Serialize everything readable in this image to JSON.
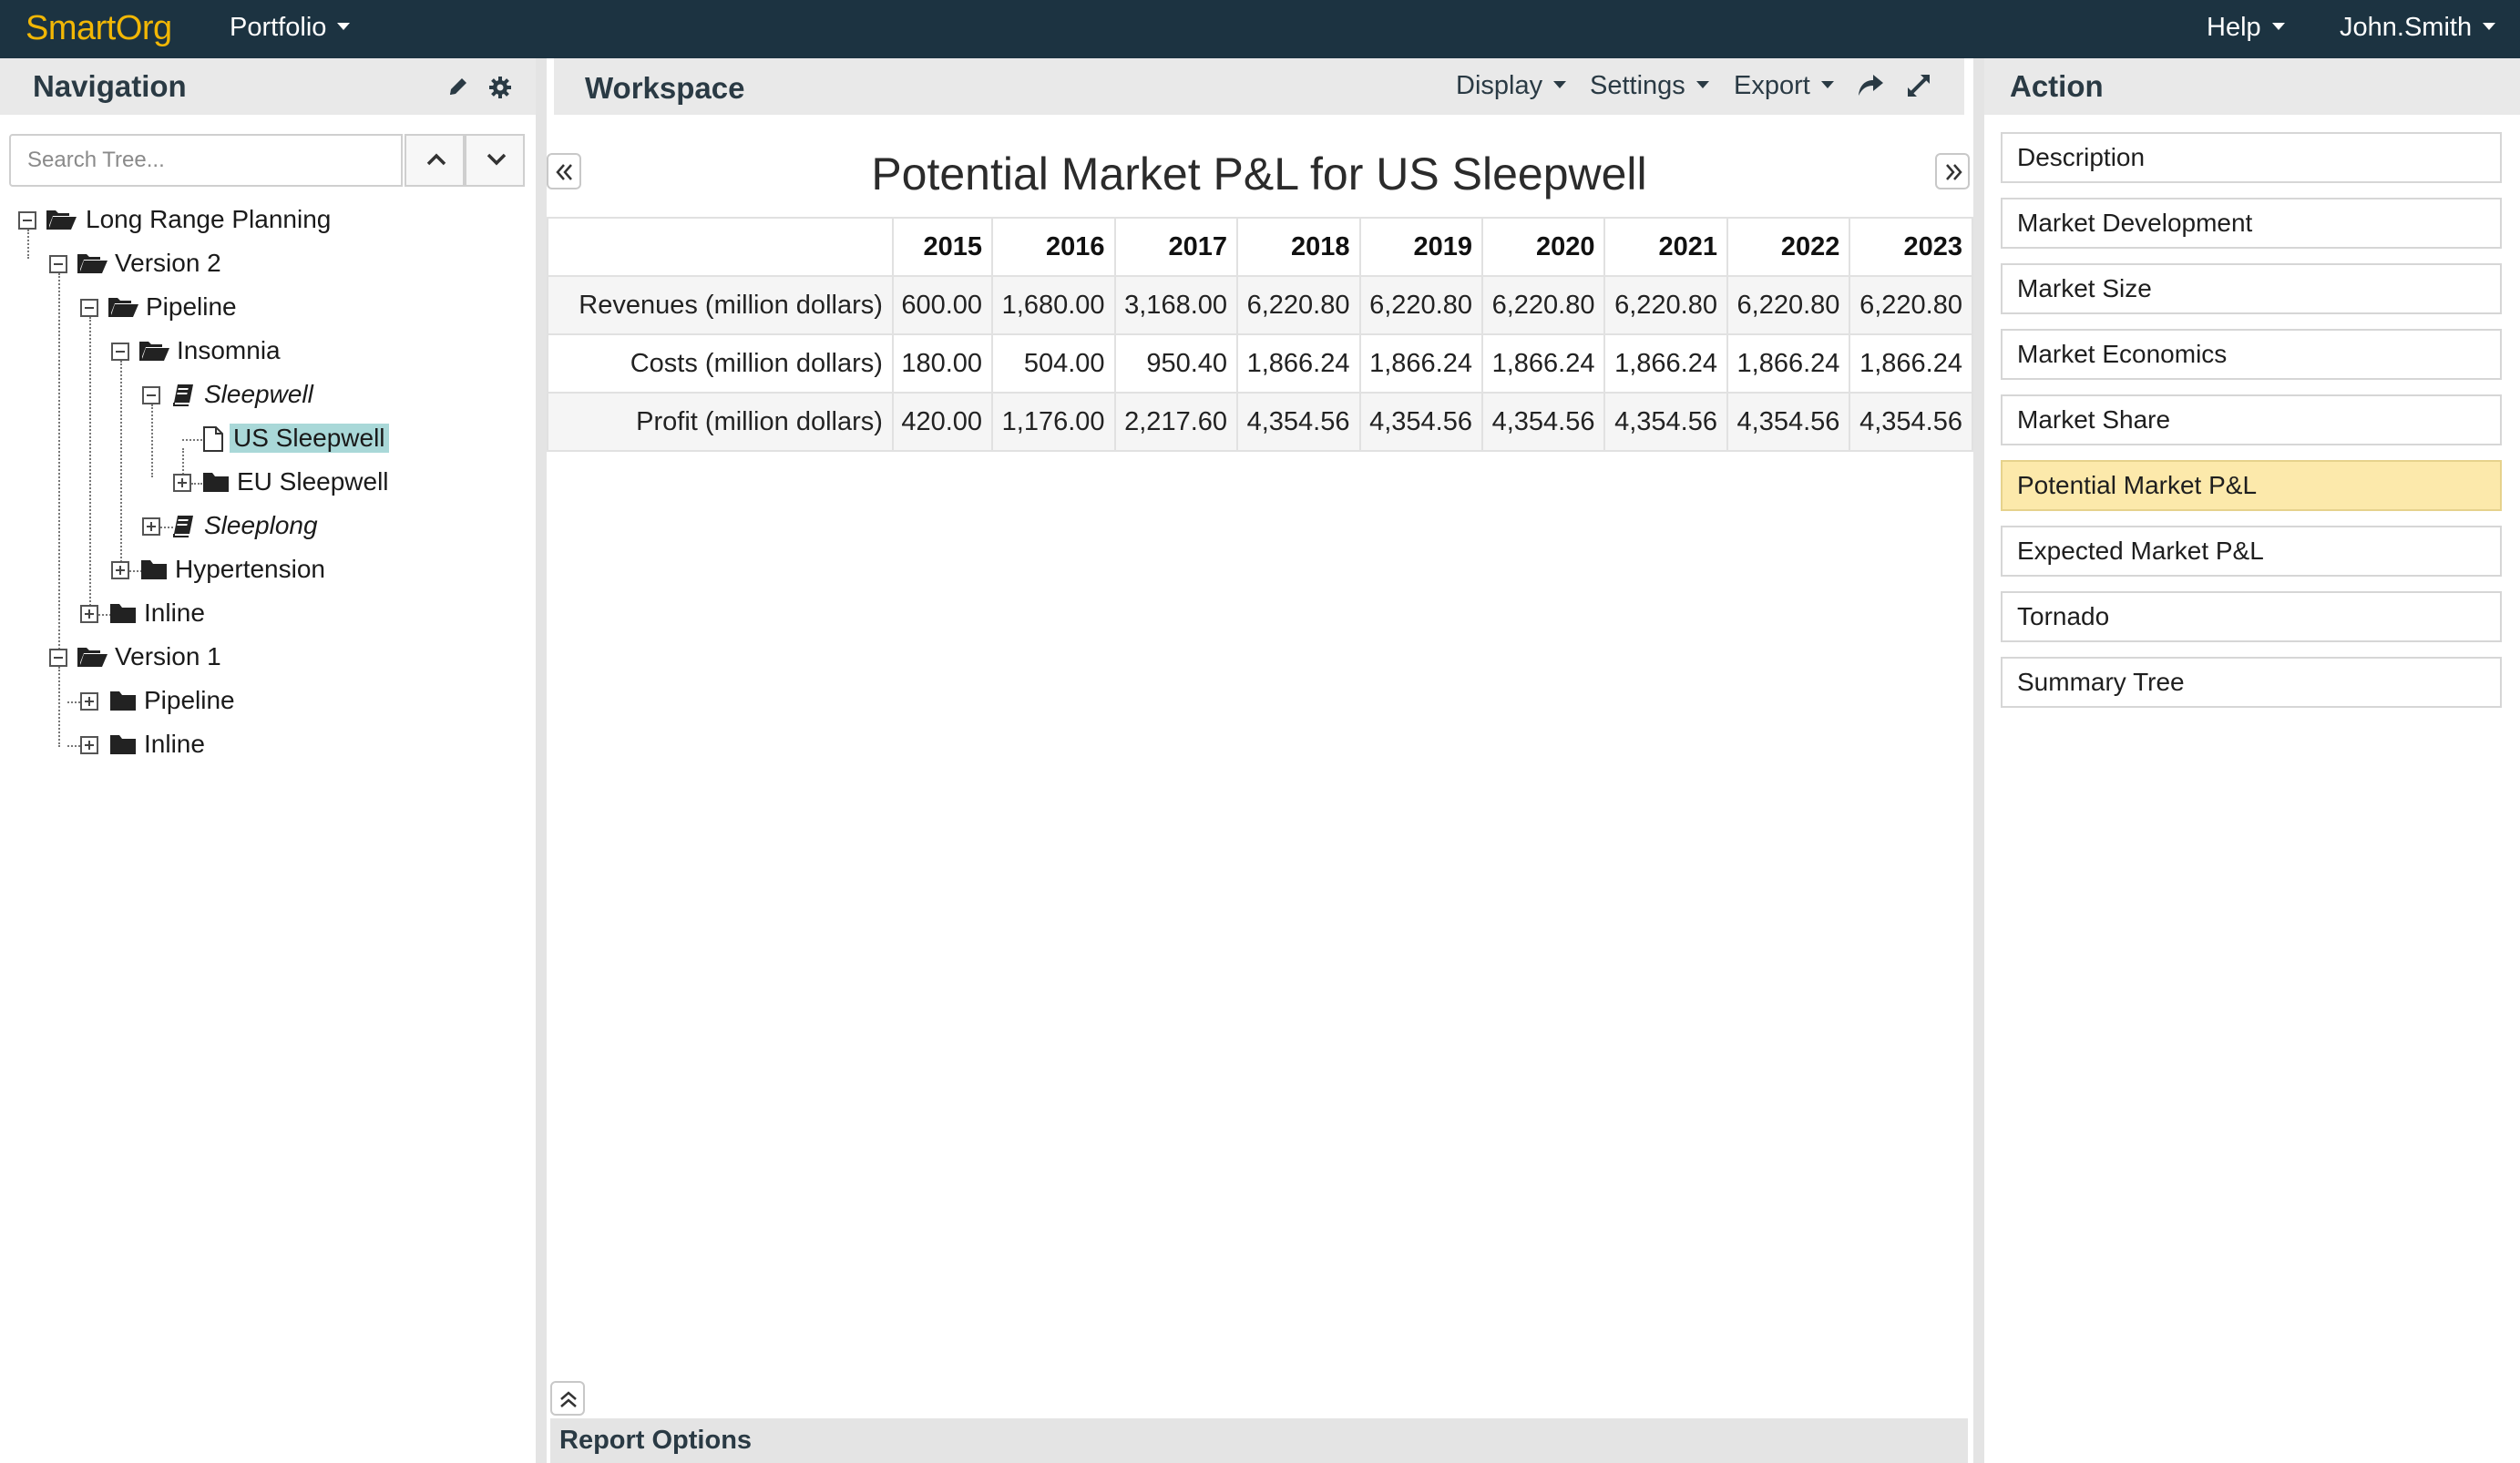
{
  "topbar": {
    "brand": "SmartOrg",
    "portfolio_label": "Portfolio",
    "help_label": "Help",
    "user_label": "John.Smith"
  },
  "navigation": {
    "title": "Navigation",
    "search_placeholder": "Search Tree...",
    "tree": [
      {
        "label": "Long Range Planning"
      },
      {
        "label": "Version 2"
      },
      {
        "label": "Pipeline"
      },
      {
        "label": "Insomnia"
      },
      {
        "label": "Sleepwell"
      },
      {
        "label": "US Sleepwell",
        "selected": true
      },
      {
        "label": "EU Sleepwell"
      },
      {
        "label": "Sleeplong"
      },
      {
        "label": "Hypertension"
      },
      {
        "label": "Inline"
      },
      {
        "label": "Version 1"
      },
      {
        "label": "Pipeline"
      },
      {
        "label": "Inline"
      }
    ]
  },
  "workspace": {
    "title": "Workspace",
    "display_label": "Display",
    "settings_label": "Settings",
    "export_label": "Export",
    "report_title": "Potential Market P&L for US Sleepwell",
    "report_options_label": "Report Options",
    "table": {
      "columns": [
        "",
        "2015",
        "2016",
        "2017",
        "2018",
        "2019",
        "2020",
        "2021",
        "2022",
        "2023"
      ],
      "rows": [
        [
          "Revenues (million dollars)",
          "600.00",
          "1,680.00",
          "3,168.00",
          "6,220.80",
          "6,220.80",
          "6,220.80",
          "6,220.80",
          "6,220.80",
          "6,220.80"
        ],
        [
          "Costs (million dollars)",
          "180.00",
          "504.00",
          "950.40",
          "1,866.24",
          "1,866.24",
          "1,866.24",
          "1,866.24",
          "1,866.24",
          "1,866.24"
        ],
        [
          "Profit (million dollars)",
          "420.00",
          "1,176.00",
          "2,217.60",
          "4,354.56",
          "4,354.56",
          "4,354.56",
          "4,354.56",
          "4,354.56",
          "4,354.56"
        ]
      ]
    }
  },
  "action": {
    "title": "Action",
    "items": [
      {
        "label": "Description"
      },
      {
        "label": "Market Development"
      },
      {
        "label": "Market Size"
      },
      {
        "label": "Market Economics"
      },
      {
        "label": "Market Share"
      },
      {
        "label": "Potential Market P&L",
        "active": true
      },
      {
        "label": "Expected Market P&L"
      },
      {
        "label": "Tornado"
      },
      {
        "label": "Summary Tree"
      }
    ]
  },
  "colors": {
    "topbar_bg": "#1c3341",
    "brand": "#f2b705",
    "selected_tree_bg": "#a9d8d8",
    "active_action_bg": "#fce9ab"
  }
}
